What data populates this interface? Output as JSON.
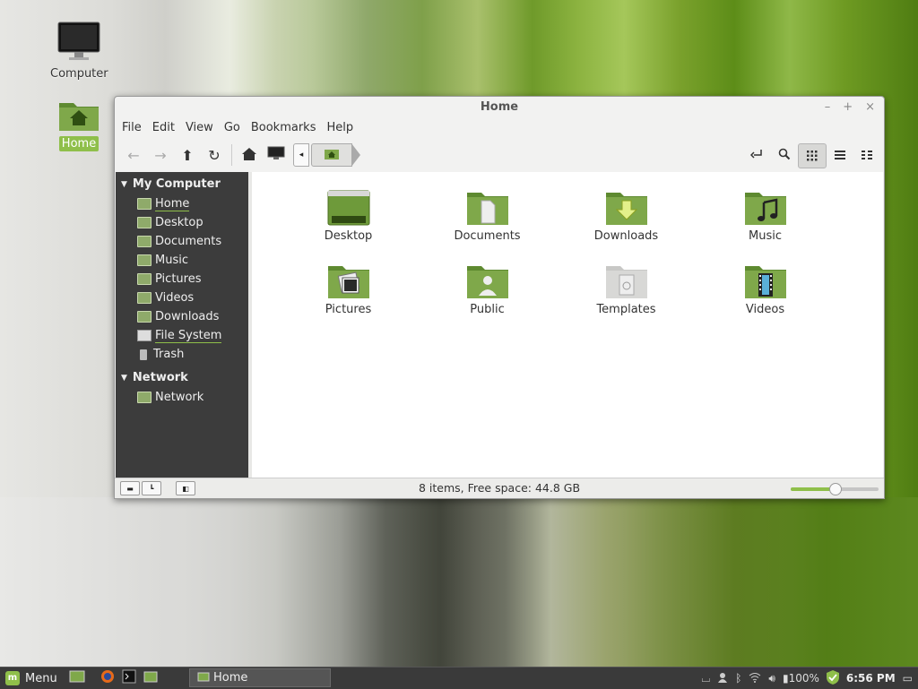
{
  "desktop": {
    "icons": [
      {
        "label": "Computer",
        "icon": "monitor-icon"
      },
      {
        "label": "Home",
        "icon": "home-folder-icon",
        "selected": true
      }
    ]
  },
  "window": {
    "title": "Home",
    "controls": {
      "minimize": "–",
      "maximize": "+",
      "close": "×"
    },
    "menu": [
      "File",
      "Edit",
      "View",
      "Go",
      "Bookmarks",
      "Help"
    ],
    "toolbar": {
      "back": "←",
      "forward": "→",
      "up": "⬆",
      "reload": "↻",
      "home": "⌂",
      "crumb_back": "◂"
    },
    "sidebar": {
      "sections": [
        {
          "title": "My Computer",
          "items": [
            "Home",
            "Desktop",
            "Documents",
            "Music",
            "Pictures",
            "Videos",
            "Downloads",
            "File System",
            "Trash"
          ]
        },
        {
          "title": "Network",
          "items": [
            "Network"
          ]
        }
      ]
    },
    "files": [
      "Desktop",
      "Documents",
      "Downloads",
      "Music",
      "Pictures",
      "Public",
      "Templates",
      "Videos"
    ],
    "status": "8 items, Free space: 44.8 GB",
    "zoom_level": 0.5
  },
  "taskbar": {
    "menu_label": "Menu",
    "task_label": "Home",
    "battery": "100%",
    "clock": "6:56 PM"
  },
  "colors": {
    "accent": "#8fbf4a",
    "sidebar_bg": "#3c3c3c",
    "folder": "#7fa84a"
  }
}
